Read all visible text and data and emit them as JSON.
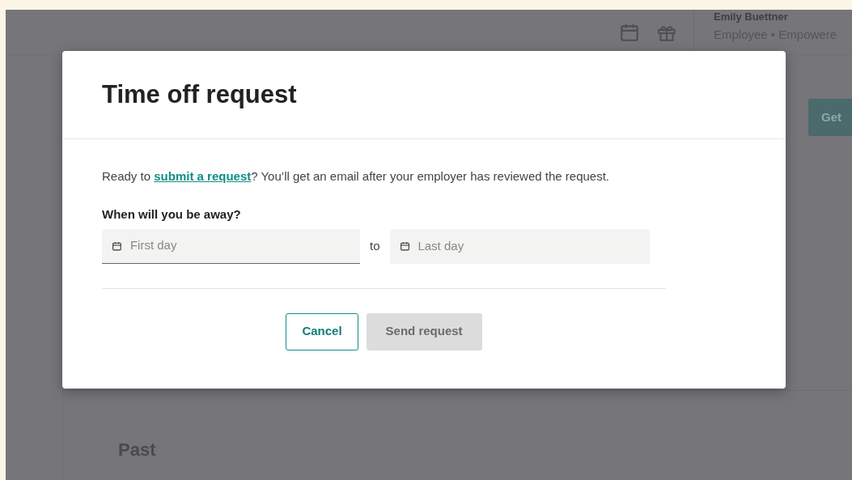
{
  "header": {
    "user_name": "Emily Buettner",
    "user_role": "Employee • Empowere"
  },
  "background": {
    "button": "Get",
    "section_title": "Past"
  },
  "dialog": {
    "title": "Time off request",
    "intro_before": "Ready to ",
    "intro_link": "submit a request",
    "intro_after": "? You’ll get an email after your employer has reviewed the request.",
    "question": "When will you be away?",
    "fields": [
      {
        "placeholder": "First day",
        "focused": true
      },
      {
        "placeholder": "Last day",
        "focused": false
      }
    ],
    "separator": "to",
    "buttons": [
      {
        "label": "Cancel",
        "kind": "outline"
      },
      {
        "label": "Send request",
        "kind": "primary",
        "disabled": true
      }
    ]
  }
}
